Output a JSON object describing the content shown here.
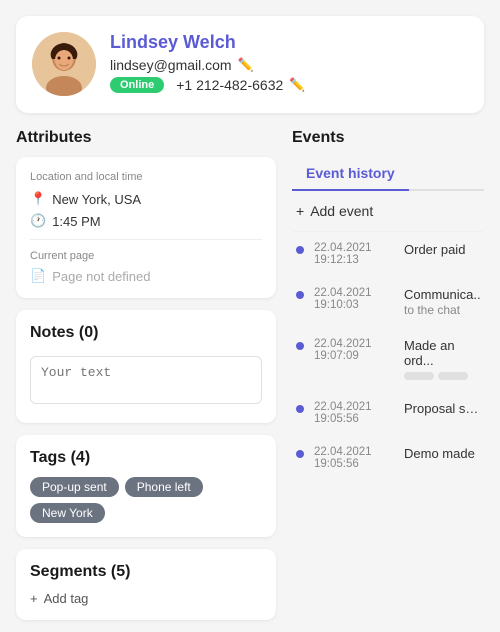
{
  "profile": {
    "name": "Lindsey Welch",
    "email": "lindsey@gmail.com",
    "phone": "+1 212-482-6632",
    "status": "Online",
    "status_color": "#2ecc71"
  },
  "attributes": {
    "title": "Attributes",
    "location_subtitle": "Location and local time",
    "location": "New York, USA",
    "time": "1:45 PM",
    "current_page_subtitle": "Current page",
    "current_page": "Page not defined"
  },
  "notes": {
    "title": "Notes (0)",
    "placeholder": "Your text"
  },
  "tags": {
    "title": "Tags (4)",
    "items": [
      "Pop-up sent",
      "Phone left",
      "New York"
    ]
  },
  "segments": {
    "title": "Segments (5)",
    "add_label": "Add tag"
  },
  "events": {
    "title": "Events",
    "tab_label": "Event history",
    "add_label": "Add event",
    "items": [
      {
        "time": "22.04.2021\n19:12:13",
        "desc": "Order paid",
        "has_pills": false
      },
      {
        "time": "22.04.2021\n19:10:03",
        "desc": "Communica... to the chat",
        "has_pills": false
      },
      {
        "time": "22.04.2021\n19:07:09",
        "desc": "Made an ord...",
        "has_pills": true
      },
      {
        "time": "22.04.2021\n19:05:56",
        "desc": "Proposal ser...",
        "has_pills": false
      },
      {
        "time": "22.04.2021\n19:05:56",
        "desc": "Demo made",
        "has_pills": false
      }
    ]
  }
}
